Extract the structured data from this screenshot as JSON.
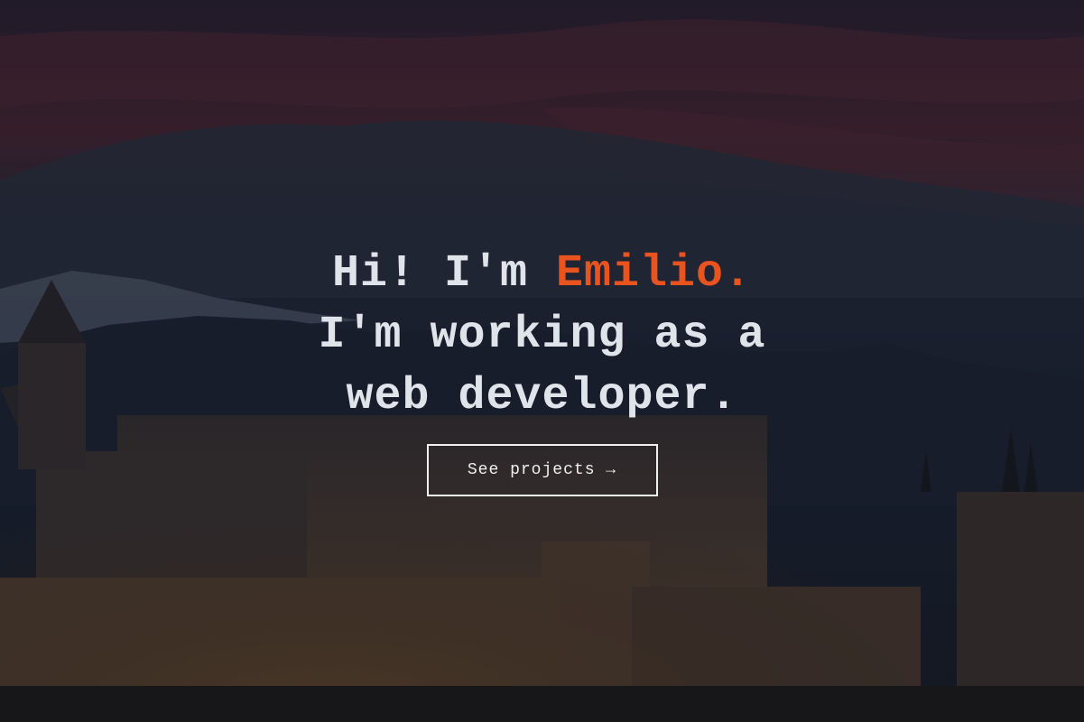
{
  "hero": {
    "greeting_prefix": "Hi! I'm ",
    "name": "Emilio.",
    "line2": "I'm working as a",
    "line3": "web developer.",
    "cta_label": "See projects →"
  },
  "colors": {
    "accent": "#e8531f",
    "headline_text": "#dfe3ea",
    "button_border": "#f0f0f0"
  }
}
